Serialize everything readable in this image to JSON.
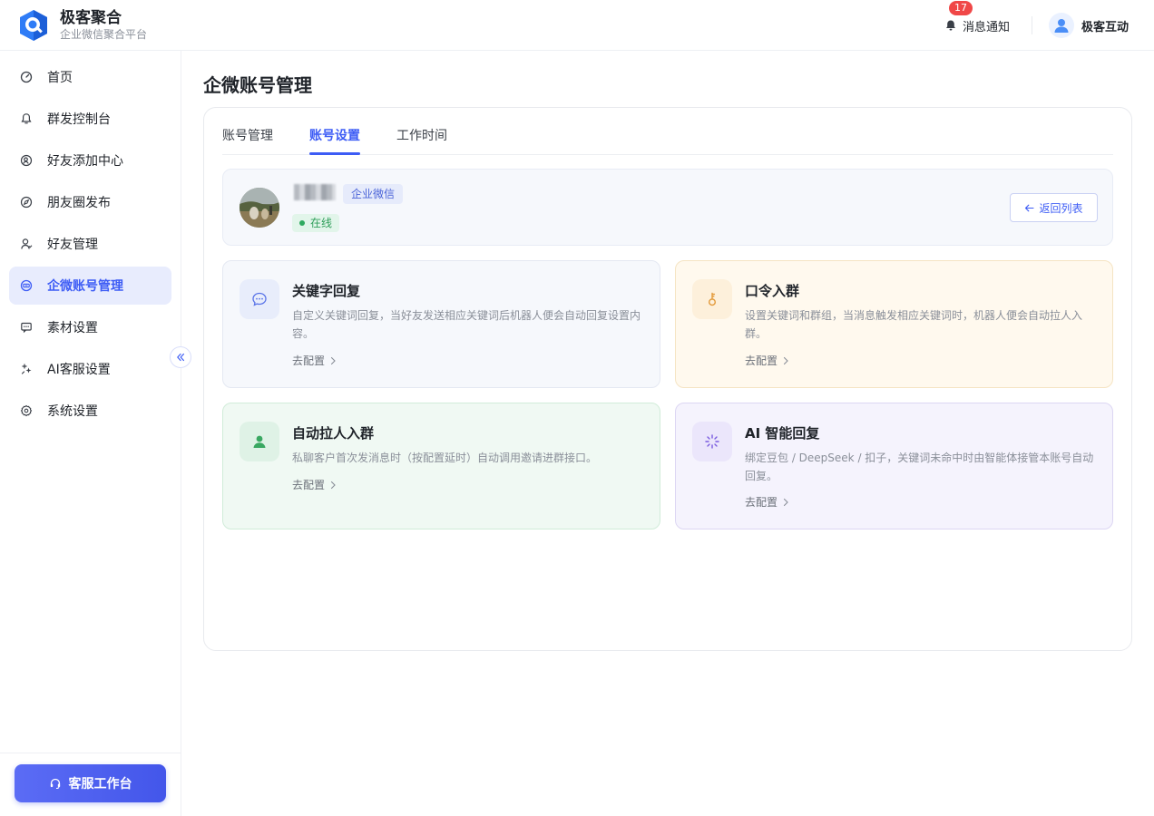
{
  "header": {
    "brand_title": "极客聚合",
    "brand_subtitle": "企业微信聚合平台",
    "notify_label": "消息通知",
    "notify_count": "17",
    "user_name": "极客互动"
  },
  "sidebar": {
    "items": [
      {
        "label": "首页",
        "icon": "dashboard-icon"
      },
      {
        "label": "群发控制台",
        "icon": "bell-icon"
      },
      {
        "label": "好友添加中心",
        "icon": "user-search-icon"
      },
      {
        "label": "朋友圈发布",
        "icon": "compass-icon"
      },
      {
        "label": "好友管理",
        "icon": "user-icon"
      },
      {
        "label": "企微账号管理",
        "icon": "account-icon",
        "active": true
      },
      {
        "label": "素材设置",
        "icon": "message-icon"
      },
      {
        "label": "AI客服设置",
        "icon": "sparkle-icon"
      },
      {
        "label": "系统设置",
        "icon": "gear-icon"
      }
    ],
    "service_button": "客服工作台"
  },
  "main": {
    "page_title": "企微账号管理",
    "tabs": [
      {
        "label": "账号管理"
      },
      {
        "label": "账号设置",
        "active": true
      },
      {
        "label": "工作时间"
      }
    ],
    "account": {
      "type_tag": "企业微信",
      "status": "在线",
      "back_button": "返回列表"
    },
    "features": [
      {
        "title": "关键字回复",
        "desc": "自定义关键词回复，当好友发送相应关键词后机器人便会自动回复设置内容。",
        "link": "去配置",
        "icon": "chat-bubble-icon"
      },
      {
        "title": "口令入群",
        "desc": "设置关键词和群组，当消息触发相应关键词时，机器人便会自动拉人入群。",
        "link": "去配置",
        "icon": "key-icon"
      },
      {
        "title": "自动拉人入群",
        "desc": "私聊客户首次发消息时（按配置延时）自动调用邀请进群接口。",
        "link": "去配置",
        "icon": "person-icon"
      },
      {
        "title": "AI 智能回复",
        "desc": "绑定豆包 / DeepSeek / 扣子，关键词未命中时由智能体接管本账号自动回复。",
        "link": "去配置",
        "icon": "ai-spark-icon"
      }
    ]
  },
  "colors": {
    "primary": "#3d5cf5",
    "online": "#2f9e5a",
    "badge": "#f04747"
  }
}
